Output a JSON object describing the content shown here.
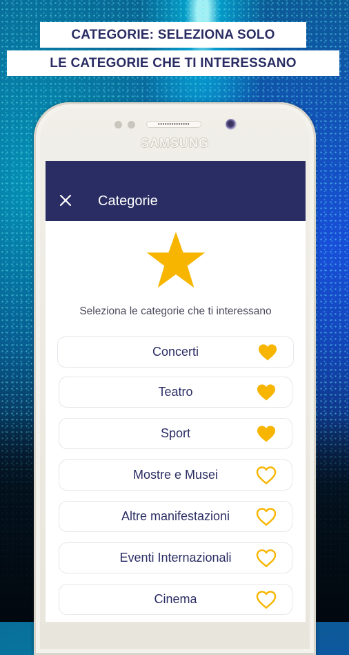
{
  "banner": {
    "line1": "CATEGORIE: SELEZIONA SOLO",
    "line2": "LE CATEGORIE CHE TI INTERESSANO"
  },
  "device": {
    "brand": "SAMSUNG",
    "speaker": "••••••••••••••"
  },
  "appbar": {
    "close_icon": "close-icon",
    "title": "Categorie",
    "background": "#2a2d63"
  },
  "header": {
    "icon": "star-icon",
    "subtitle": "Seleziona le categorie che ti interessano"
  },
  "colors": {
    "accent": "#f7b500",
    "text": "#2a2d63"
  },
  "categories": [
    {
      "label": "Concerti",
      "selected": true
    },
    {
      "label": "Teatro",
      "selected": true
    },
    {
      "label": "Sport",
      "selected": true
    },
    {
      "label": "Mostre e Musei",
      "selected": false
    },
    {
      "label": "Altre manifestazioni",
      "selected": false
    },
    {
      "label": "Eventi Internazionali",
      "selected": false
    },
    {
      "label": "Cinema",
      "selected": false
    }
  ]
}
